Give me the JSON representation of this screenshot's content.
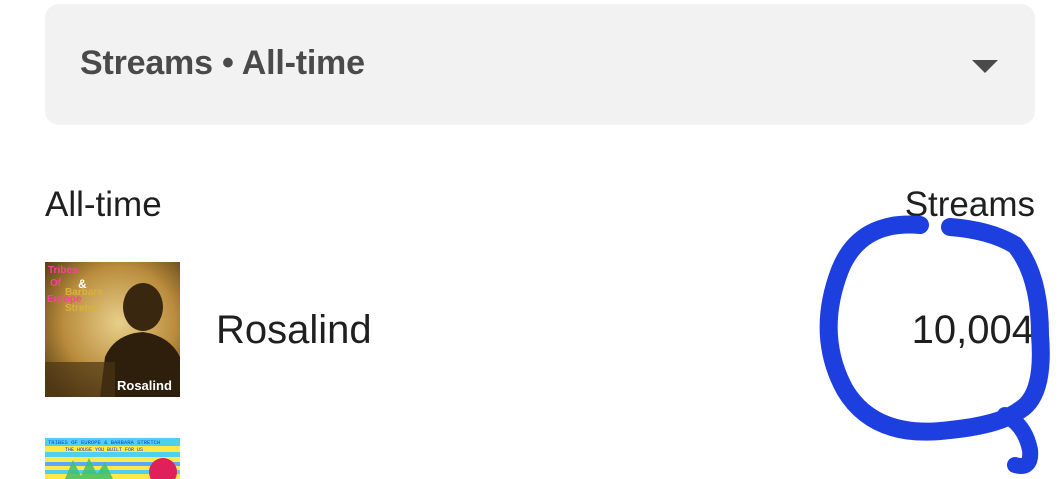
{
  "filter": {
    "label": "Streams • All-time"
  },
  "table": {
    "period_header": "All-time",
    "metric_header": "Streams"
  },
  "tracks": [
    {
      "title": "Rosalind",
      "streams": "10,004",
      "cover": {
        "text_lines": [
          "Tribes",
          "Of",
          "&",
          "Barbara",
          "Europe",
          "Stretch"
        ],
        "caption": "Rosalind"
      }
    },
    {
      "cover": {
        "text_lines": [
          "TRIBES OF EUROPE & BARBARA STRETCH",
          "THE HOUSE YOU BUILT FOR US"
        ]
      }
    }
  ],
  "colors": {
    "dropdown_bg": "#f2f2f2",
    "annotation_blue": "#1e3fe0"
  }
}
